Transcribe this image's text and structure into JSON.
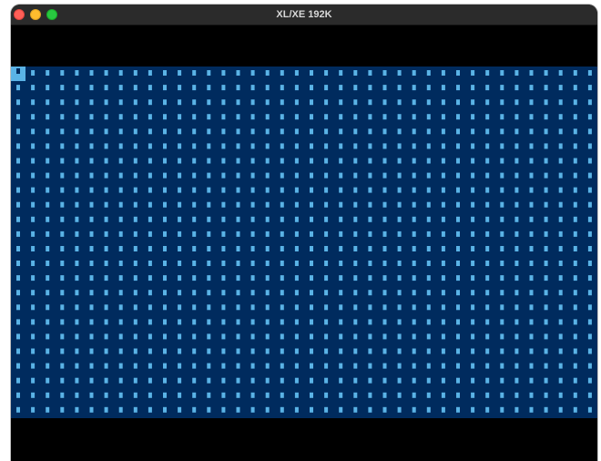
{
  "window": {
    "title": "XL/XE 192K"
  },
  "colors": {
    "border": "#000000",
    "playfield_background": "#002b5e",
    "character": "#5ab3e6",
    "titlebar": "#2b2b2b"
  },
  "screen": {
    "columns": 40,
    "rows": 24,
    "fill_character": "▮",
    "cursor_row": 1,
    "cursor_column": 1
  }
}
